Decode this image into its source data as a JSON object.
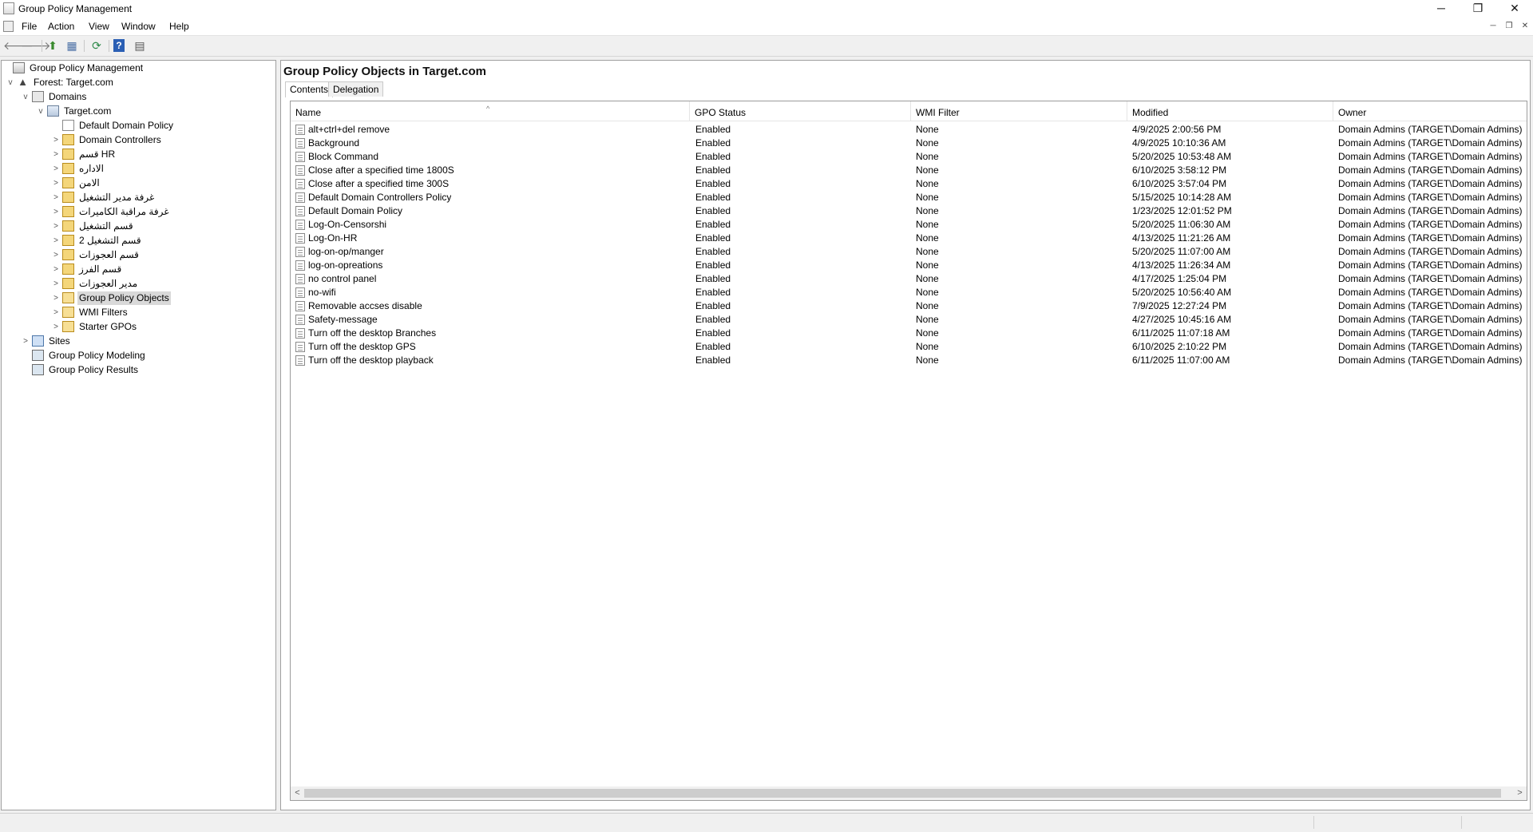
{
  "window": {
    "title": "Group Policy Management",
    "controls": {
      "minimize": "─",
      "restore": "❐",
      "close": "✕"
    }
  },
  "menubar": {
    "items": [
      "File",
      "Action",
      "View",
      "Window",
      "Help"
    ],
    "mdi_controls": {
      "minimize": "─",
      "restore": "❐",
      "close": "✕"
    }
  },
  "toolbar": {
    "back": "🡐",
    "forward": "🡒",
    "up": "⬆",
    "show_hide": "▦",
    "refresh": "⟳",
    "help": "?",
    "console": "▤"
  },
  "tree": {
    "items": [
      {
        "label": "Group Policy Management",
        "icon": "gpm-icon",
        "expander": ""
      },
      {
        "label": "Forest: Target.com",
        "icon": "forest-icon",
        "expander": "v"
      },
      {
        "label": "Domains",
        "icon": "domains-icon",
        "expander": "v"
      },
      {
        "label": "Target.com",
        "icon": "domain-icon",
        "expander": "v"
      },
      {
        "label": "Default Domain Policy",
        "icon": "gpo-link-icon",
        "expander": ""
      },
      {
        "label": "Domain Controllers",
        "icon": "ou-icon",
        "expander": ">"
      },
      {
        "label": "قسم HR",
        "icon": "ou-icon",
        "expander": ">"
      },
      {
        "label": "الاداره",
        "icon": "ou-icon",
        "expander": ">"
      },
      {
        "label": "الامن",
        "icon": "ou-icon",
        "expander": ">"
      },
      {
        "label": "غرفة مدير التشغيل",
        "icon": "ou-icon",
        "expander": ">"
      },
      {
        "label": "غرفة مراقبة الكاميرات",
        "icon": "ou-icon",
        "expander": ">"
      },
      {
        "label": "قسم التشغيل",
        "icon": "ou-icon",
        "expander": ">"
      },
      {
        "label": "قسم التشغيل 2",
        "icon": "ou-icon",
        "expander": ">"
      },
      {
        "label": "قسم العجوزات",
        "icon": "ou-icon",
        "expander": ">"
      },
      {
        "label": "قسم الفرز",
        "icon": "ou-icon",
        "expander": ">"
      },
      {
        "label": "مدير العجوزات",
        "icon": "ou-icon",
        "expander": ">"
      },
      {
        "label": "Group Policy Objects",
        "icon": "folder-icon",
        "expander": ">"
      },
      {
        "label": "WMI Filters",
        "icon": "folder-icon",
        "expander": ">"
      },
      {
        "label": "Starter GPOs",
        "icon": "folder-icon",
        "expander": ">"
      },
      {
        "label": "Sites",
        "icon": "sites-icon",
        "expander": ">"
      },
      {
        "label": "Group Policy Modeling",
        "icon": "modeling-icon",
        "expander": ""
      },
      {
        "label": "Group Policy Results",
        "icon": "results-icon",
        "expander": ""
      }
    ]
  },
  "content": {
    "title": "Group Policy Objects in Target.com",
    "tabs": [
      "Contents",
      "Delegation"
    ],
    "sort_indicator": "^",
    "columns": [
      "Name",
      "GPO Status",
      "WMI Filter",
      "Modified",
      "Owner"
    ],
    "rows": [
      {
        "name": "alt+ctrl+del remove",
        "status": "Enabled",
        "wmi": "None",
        "modified": "4/9/2025 2:00:56 PM",
        "owner": "Domain Admins (TARGET\\Domain Admins)"
      },
      {
        "name": "Background",
        "status": "Enabled",
        "wmi": "None",
        "modified": "4/9/2025 10:10:36 AM",
        "owner": "Domain Admins (TARGET\\Domain Admins)"
      },
      {
        "name": "Block Command",
        "status": "Enabled",
        "wmi": "None",
        "modified": "5/20/2025 10:53:48 AM",
        "owner": "Domain Admins (TARGET\\Domain Admins)"
      },
      {
        "name": "Close after a specified time 1800S",
        "status": "Enabled",
        "wmi": "None",
        "modified": "6/10/2025 3:58:12 PM",
        "owner": "Domain Admins (TARGET\\Domain Admins)"
      },
      {
        "name": "Close after a specified time 300S",
        "status": "Enabled",
        "wmi": "None",
        "modified": "6/10/2025 3:57:04 PM",
        "owner": "Domain Admins (TARGET\\Domain Admins)"
      },
      {
        "name": "Default Domain Controllers Policy",
        "status": "Enabled",
        "wmi": "None",
        "modified": "5/15/2025 10:14:28 AM",
        "owner": "Domain Admins (TARGET\\Domain Admins)"
      },
      {
        "name": "Default Domain Policy",
        "status": "Enabled",
        "wmi": "None",
        "modified": "1/23/2025 12:01:52 PM",
        "owner": "Domain Admins (TARGET\\Domain Admins)"
      },
      {
        "name": "Log-On-Censorshi",
        "status": "Enabled",
        "wmi": "None",
        "modified": "5/20/2025 11:06:30 AM",
        "owner": "Domain Admins (TARGET\\Domain Admins)"
      },
      {
        "name": "Log-On-HR",
        "status": "Enabled",
        "wmi": "None",
        "modified": "4/13/2025 11:21:26 AM",
        "owner": "Domain Admins (TARGET\\Domain Admins)"
      },
      {
        "name": "log-on-op/manger",
        "status": "Enabled",
        "wmi": "None",
        "modified": "5/20/2025 11:07:00 AM",
        "owner": "Domain Admins (TARGET\\Domain Admins)"
      },
      {
        "name": "log-on-opreations",
        "status": "Enabled",
        "wmi": "None",
        "modified": "4/13/2025 11:26:34 AM",
        "owner": "Domain Admins (TARGET\\Domain Admins)"
      },
      {
        "name": "no control panel",
        "status": "Enabled",
        "wmi": "None",
        "modified": "4/17/2025 1:25:04 PM",
        "owner": "Domain Admins (TARGET\\Domain Admins)"
      },
      {
        "name": "no-wifi",
        "status": "Enabled",
        "wmi": "None",
        "modified": "5/20/2025 10:56:40 AM",
        "owner": "Domain Admins (TARGET\\Domain Admins)"
      },
      {
        "name": "Removable accses disable",
        "status": "Enabled",
        "wmi": "None",
        "modified": "7/9/2025 12:27:24 PM",
        "owner": "Domain Admins (TARGET\\Domain Admins)"
      },
      {
        "name": "Safety-message",
        "status": "Enabled",
        "wmi": "None",
        "modified": "4/27/2025 10:45:16 AM",
        "owner": "Domain Admins (TARGET\\Domain Admins)"
      },
      {
        "name": "Turn off the desktop Branches",
        "status": "Enabled",
        "wmi": "None",
        "modified": "6/11/2025 11:07:18 AM",
        "owner": "Domain Admins (TARGET\\Domain Admins)"
      },
      {
        "name": "Turn off the desktop GPS",
        "status": "Enabled",
        "wmi": "None",
        "modified": "6/10/2025 2:10:22 PM",
        "owner": "Domain Admins (TARGET\\Domain Admins)"
      },
      {
        "name": "Turn off the desktop playback",
        "status": "Enabled",
        "wmi": "None",
        "modified": "6/11/2025 11:07:00 AM",
        "owner": "Domain Admins (TARGET\\Domain Admins)"
      }
    ],
    "scroll_arrows": {
      "left": "<",
      "right": ">"
    }
  }
}
